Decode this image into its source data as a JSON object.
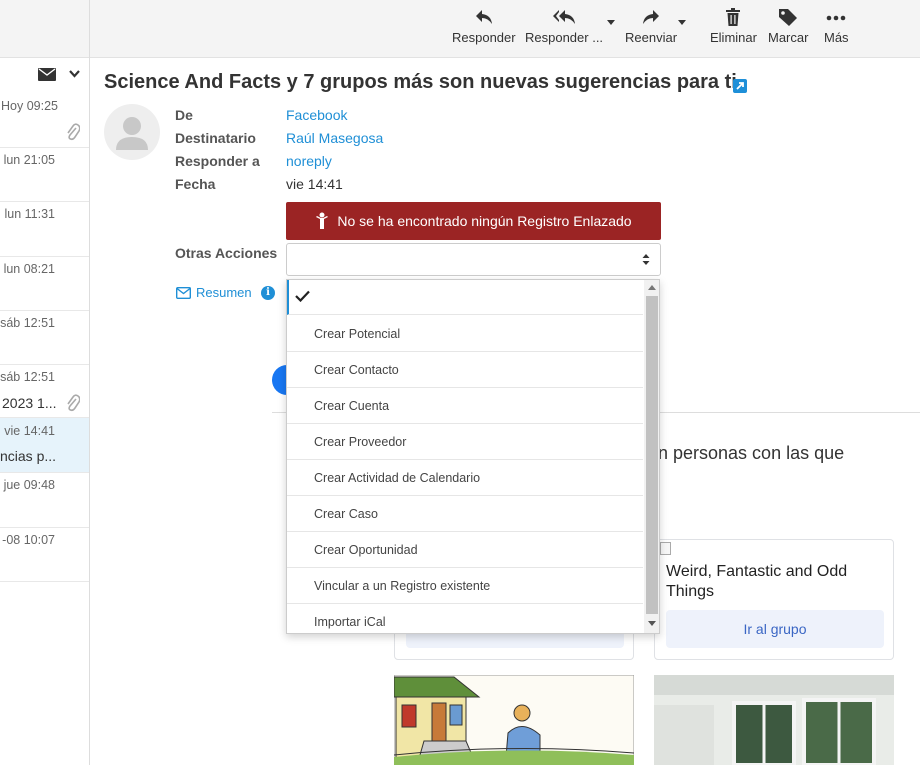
{
  "toolbar": {
    "responder": "Responder",
    "responder_todos": "Responder ...",
    "reenviar": "Reenviar",
    "eliminar": "Eliminar",
    "marcar": "Marcar",
    "mas": "Más"
  },
  "message_list": [
    {
      "time": "Hoy 09:25",
      "subject": "",
      "attachment": true
    },
    {
      "time": "lun 21:05",
      "subject": ""
    },
    {
      "time": "lun 11:31",
      "subject": ""
    },
    {
      "time": "lun 08:21",
      "subject": ""
    },
    {
      "time": "sáb 12:51",
      "subject": ""
    },
    {
      "time": "sáb 12:51",
      "subject": "2023 1...",
      "attachment": true
    },
    {
      "time": "vie 14:41",
      "subject": "ncias p...",
      "active": true
    },
    {
      "time": "jue 09:48",
      "subject": ""
    },
    {
      "time": "-08 10:07",
      "subject": ""
    }
  ],
  "email": {
    "title": "Science And Facts y 7 grupos más son nuevas sugerencias para ti",
    "labels": {
      "de": "De",
      "destinatario": "Destinatario",
      "responder_a": "Responder a",
      "fecha": "Fecha",
      "otras_acciones": "Otras Acciones"
    },
    "values": {
      "de": "Facebook",
      "destinatario": "Raúl Masegosa",
      "responder_a": "noreply",
      "fecha": "vie 14:41"
    },
    "no_record_banner": "No se ha encontrado ningún Registro Enlazado",
    "resumen": "Resumen"
  },
  "dropdown": {
    "options": [
      "Crear Potencial",
      "Crear Contacto",
      "Crear Cuenta",
      "Crear Proveedor",
      "Crear Actividad de Calendario",
      "Crear Caso",
      "Crear Oportunidad",
      "Vincular a un Registro existente",
      "Importar iCal"
    ]
  },
  "body": {
    "text_fragment": "n personas con las que",
    "card_title": "Weird, Fantastic and Odd Things",
    "card_button": "Ir al grupo"
  },
  "colors": {
    "accent": "#1f8fd6",
    "banner": "#9b2424",
    "facebook_blue": "#1877f2"
  }
}
